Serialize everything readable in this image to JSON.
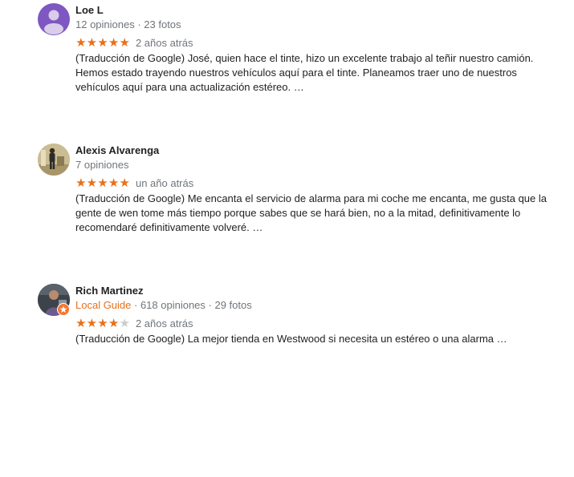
{
  "reviews": [
    {
      "name": "Loe L",
      "meta": "12 opiniones · 23 fotos",
      "local_guide": "",
      "rating": 5,
      "when": "2 años atrás",
      "text": "(Traducción de Google) José, quien hace el tinte, hizo un excelente trabajo al teñir nuestro camión. Hemos estado trayendo nuestros vehículos aquí para el tinte. Planeamos traer uno de nuestros vehículos aquí para una actualización estéreo. …",
      "avatar": "default-person-icon"
    },
    {
      "name": "Alexis Alvarenga",
      "meta": "7 opiniones",
      "local_guide": "",
      "rating": 5,
      "when": "un año atrás",
      "text": "(Traducción de Google) Me encanta el servicio de alarma para mi coche me encanta, me gusta que la gente de wen tome más tiempo porque sabes que se hará bien, no a la mitad, definitivamente lo recomendaré definitivamente volveré. …",
      "avatar": "profile-photo"
    },
    {
      "name": "Rich Martinez",
      "meta": "618 opiniones · 29 fotos",
      "local_guide": "Local Guide",
      "rating": 4,
      "when": "2 años atrás",
      "text": "(Traducción de Google) La mejor tienda en Westwood si necesita un estéreo o una alarma …",
      "avatar": "profile-photo"
    }
  ],
  "colors": {
    "star_on": "#e7711b",
    "star_off": "#cccccc",
    "local_guide": "#e7711b",
    "meta": "#70757a",
    "avatar_purple": "#7e57c2"
  },
  "separator": " · "
}
